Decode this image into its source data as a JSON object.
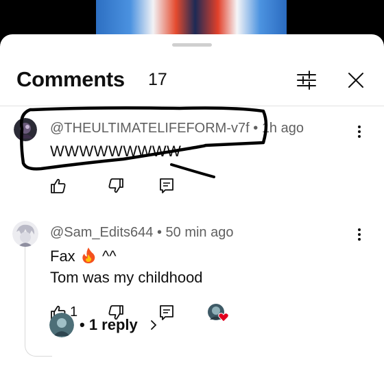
{
  "header": {
    "title": "Comments",
    "count": "17"
  },
  "comments": [
    {
      "author": "@THEULTIMATELIFEFORM-v7f",
      "time": "1h ago",
      "lines": [
        "WWWWWWWWW"
      ],
      "likes": ""
    },
    {
      "author": "@Sam_Edits644",
      "time": "50 min ago",
      "lines": [
        "Fax",
        "^^",
        "Tom was my childhood"
      ],
      "likes": "1",
      "replies_label": "• 1 reply"
    }
  ],
  "icons": {
    "filter": "sliders-icon",
    "close": "close-icon",
    "like": "thumbs-up-icon",
    "dislike": "thumbs-down-icon",
    "reply": "reply-icon",
    "more": "more-vert-icon",
    "heart": "heart-icon",
    "fire": "fire-emoji",
    "chevron": "chevron-right-icon"
  },
  "colors": {
    "heart": "#e1001e",
    "annotation": "#000000"
  }
}
